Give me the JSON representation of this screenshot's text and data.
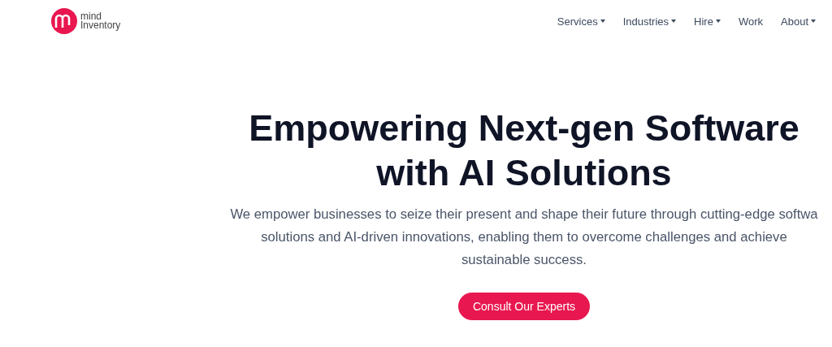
{
  "logo": {
    "line_1": "mind",
    "line_2": "Inventory"
  },
  "nav": [
    {
      "label": "Services",
      "dropdown": true
    },
    {
      "label": "Industries",
      "dropdown": true
    },
    {
      "label": "Hire",
      "dropdown": true
    },
    {
      "label": "Work",
      "dropdown": false
    },
    {
      "label": "About",
      "dropdown": true
    }
  ],
  "hero": {
    "heading_lines": [
      "Empowering Next-gen Software",
      "with AI Solutions"
    ],
    "paragraph_lines": [
      "We empower businesses to seize their present and shape their future through cutting-edge softwa",
      "solutions and AI-driven innovations, enabling them to overcome challenges and achieve",
      "sustainable success."
    ],
    "button": "Consult Our Experts"
  }
}
